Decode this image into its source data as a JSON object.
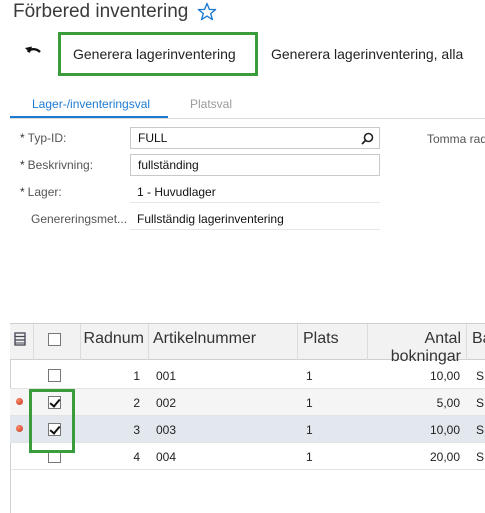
{
  "page": {
    "title": "Förbered inventering"
  },
  "toolbar": {
    "generate_label": "Generera lagerinventering",
    "generate_all_label": "Generera lagerinventering, alla"
  },
  "tabs": [
    {
      "label": "Lager-/inventeringsval",
      "active": true
    },
    {
      "label": "Platsval",
      "active": false
    }
  ],
  "form": {
    "type_id": {
      "label": "Typ-ID:",
      "value": "FULL"
    },
    "description": {
      "label": "Beskrivning:",
      "value": "fullständing"
    },
    "warehouse": {
      "label": "Lager:",
      "value": "1 - Huvudlager"
    },
    "generation_method": {
      "label": "Genereringsmet...",
      "value": "Fullständig lagerinventering"
    },
    "empty_rows_label": "Tomma rad"
  },
  "grid": {
    "headers": {
      "rownum": "Radnum",
      "article": "Artikelnummer",
      "location": "Plats",
      "bookings_line1": "Antal",
      "bookings_line2": "bokningar",
      "extra": "Ba"
    },
    "rows": [
      {
        "rownum": "1",
        "article": "001",
        "location": "1",
        "bookings": "10,00",
        "extra": "S",
        "checked": false,
        "error": false
      },
      {
        "rownum": "2",
        "article": "002",
        "location": "1",
        "bookings": "5,00",
        "extra": "S",
        "checked": true,
        "error": true
      },
      {
        "rownum": "3",
        "article": "003",
        "location": "1",
        "bookings": "10,00",
        "extra": "S",
        "checked": true,
        "error": true
      },
      {
        "rownum": "4",
        "article": "004",
        "location": "1",
        "bookings": "20,00",
        "extra": "S",
        "checked": false,
        "error": false
      }
    ]
  },
  "colors": {
    "accent": "#1e7bd3",
    "highlight": "#3a9c3a",
    "error_dot": "#c0341b"
  }
}
